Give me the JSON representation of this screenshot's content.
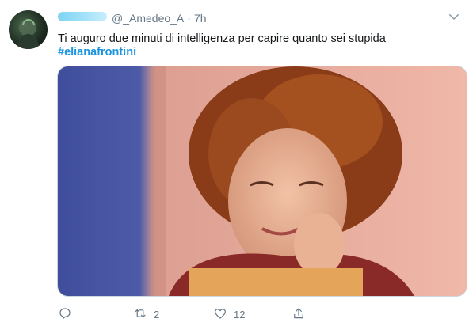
{
  "tweet": {
    "handle": "@_Amedeo_A",
    "separator": "·",
    "time": "7h",
    "text": "Ti auguro due minuti di intelligenza per capire quanto sei stupida",
    "hashtag": "#elianafrontini"
  },
  "actions": {
    "reply_count": "",
    "retweet_count": "2",
    "like_count": "12",
    "share_count": ""
  },
  "icons": [
    "avatar",
    "chevron-down-icon",
    "reply-icon",
    "retweet-icon",
    "like-icon",
    "share-icon"
  ],
  "colors": {
    "link": "#1b95e0",
    "muted": "#657786",
    "text": "#14171a"
  }
}
